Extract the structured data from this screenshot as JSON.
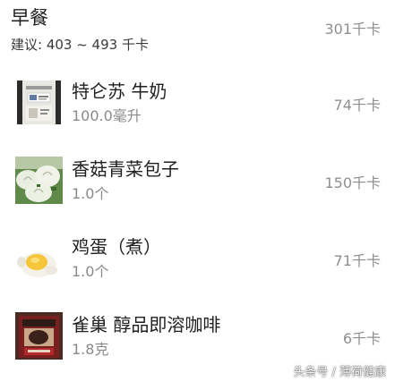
{
  "meal": {
    "title": "早餐",
    "suggestion": "建议: 403 ~ 493 千卡",
    "total": "301千卡"
  },
  "foods": [
    {
      "name": "特仑苏 牛奶",
      "amount": "100.0毫升",
      "calories": "74千卡",
      "thumbnail_icon": "milk-carton-icon"
    },
    {
      "name": "香菇青菜包子",
      "amount": "1.0个",
      "calories": "150千卡",
      "thumbnail_icon": "steamed-bun-icon"
    },
    {
      "name": "鸡蛋（煮）",
      "amount": "1.0个",
      "calories": "71千卡",
      "thumbnail_icon": "boiled-egg-icon"
    },
    {
      "name": "雀巢 醇品即溶咖啡",
      "amount": "1.8克",
      "calories": "6千卡",
      "thumbnail_icon": "coffee-jar-icon"
    }
  ],
  "watermark": "头条号 / 薄荷健康"
}
